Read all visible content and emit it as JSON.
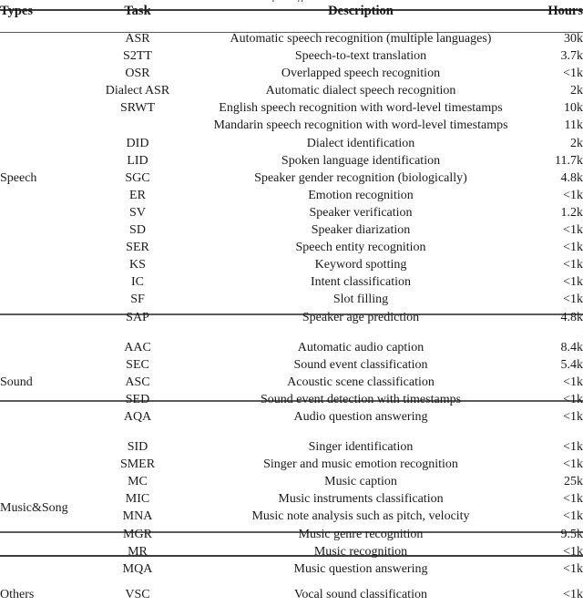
{
  "caption_fragment": "pmoisgni",
  "table": {
    "headers": {
      "types": "Types",
      "task": "Task",
      "description": "Description",
      "hours": "Hours"
    },
    "sections": [
      {
        "type_label": "Speech",
        "rows": [
          {
            "task": "ASR",
            "description": "Automatic speech recognition (multiple languages)",
            "hours": "30k"
          },
          {
            "task": "S2TT",
            "description": "Speech-to-text translation",
            "hours": "3.7k"
          },
          {
            "task": "OSR",
            "description": "Overlapped speech recognition",
            "hours": "<1k"
          },
          {
            "task": "Dialect ASR",
            "description": "Automatic dialect speech recognition",
            "hours": "2k"
          },
          {
            "task": "SRWT",
            "description": "English speech recognition with word-level timestamps",
            "hours": "10k"
          },
          {
            "task": "",
            "description": "Mandarin speech recognition with word-level timestamps",
            "hours": "11k"
          },
          {
            "task": "DID",
            "description": "Dialect identification",
            "hours": "2k"
          },
          {
            "task": "LID",
            "description": "Spoken language identification",
            "hours": "11.7k"
          },
          {
            "task": "SGC",
            "description": "Speaker gender recognition (biologically)",
            "hours": "4.8k"
          },
          {
            "task": "ER",
            "description": "Emotion recognition",
            "hours": "<1k"
          },
          {
            "task": "SV",
            "description": "Speaker verification",
            "hours": "1.2k"
          },
          {
            "task": "SD",
            "description": "Speaker diarization",
            "hours": "<1k"
          },
          {
            "task": "SER",
            "description": "Speech entity recognition",
            "hours": "<1k"
          },
          {
            "task": "KS",
            "description": "Keyword spotting",
            "hours": "<1k"
          },
          {
            "task": "IC",
            "description": "Intent classification",
            "hours": "<1k"
          },
          {
            "task": "SF",
            "description": "Slot filling",
            "hours": "<1k"
          },
          {
            "task": "SAP",
            "description": "Speaker age prediction",
            "hours": "4.8k"
          }
        ],
        "label_row_index": 8
      },
      {
        "type_label": "Sound",
        "rows": [
          {
            "task": "AAC",
            "description": "Automatic audio caption",
            "hours": "8.4k"
          },
          {
            "task": "SEC",
            "description": "Sound event classification",
            "hours": "5.4k"
          },
          {
            "task": "ASC",
            "description": "Acoustic scene classification",
            "hours": "<1k"
          },
          {
            "task": "SED",
            "description": "Sound event detection with timestamps",
            "hours": "<1k"
          },
          {
            "task": "AQA",
            "description": "Audio question answering",
            "hours": "<1k"
          }
        ],
        "label_row_index": 2
      },
      {
        "type_label": "Music&Song",
        "rows": [
          {
            "task": "SID",
            "description": "Singer identification",
            "hours": "<1k"
          },
          {
            "task": "SMER",
            "description": "Singer and music emotion recognition",
            "hours": "<1k"
          },
          {
            "task": "MC",
            "description": "Music caption",
            "hours": "25k"
          },
          {
            "task": "MIC",
            "description": "Music instruments classification",
            "hours": "<1k"
          },
          {
            "task": "MNA",
            "description": "Music note analysis such as pitch, velocity",
            "hours": "<1k"
          },
          {
            "task": "MGR",
            "description": "Music genre recognition",
            "hours": "9.5k"
          },
          {
            "task": "MR",
            "description": "Music recognition",
            "hours": "<1k"
          },
          {
            "task": "MQA",
            "description": "Music question answering",
            "hours": "<1k"
          }
        ],
        "label_row_index": 4
      },
      {
        "type_label": "Others",
        "rows": [
          {
            "task": "VSC",
            "description": "Vocal sound classification",
            "hours": "<1k"
          }
        ],
        "label_row_index": 0
      }
    ]
  }
}
